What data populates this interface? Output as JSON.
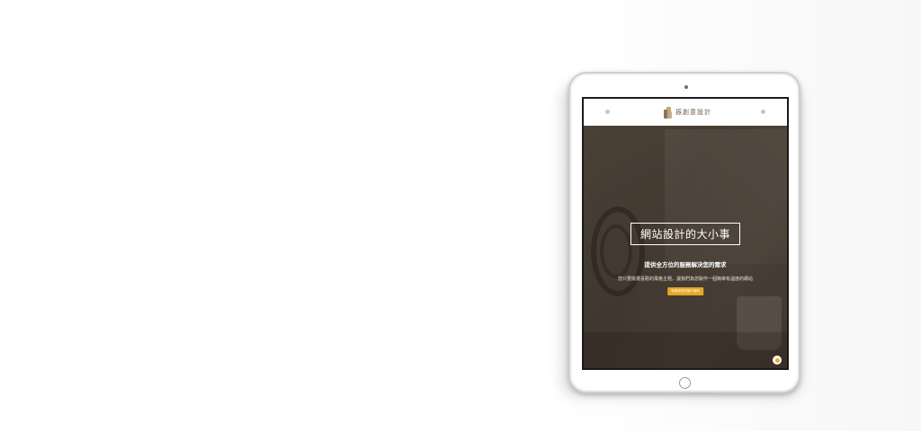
{
  "site": {
    "logo_text": "振創意設計",
    "hero": {
      "title": "網站設計的大小事",
      "subtitle": "提供全方位的服務解決您的需求",
      "description": "您只要挑選喜歡的風格主題，讓我們為您製作一個簡單有溫度的網站",
      "cta_label": "查看我們的客戶案例"
    }
  },
  "colors": {
    "accent": "#e8a825",
    "hero_overlay": "#4a4038",
    "header_bg": "#ffffff"
  },
  "icons": {
    "chat": "chat-bubble-icon",
    "logo": "brand-logo-icon"
  }
}
